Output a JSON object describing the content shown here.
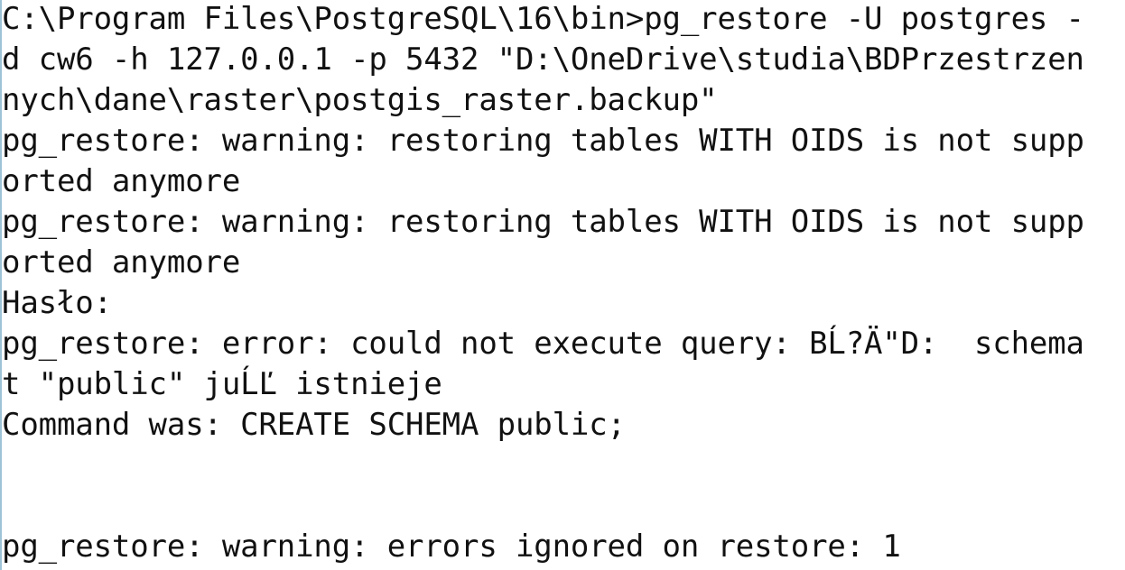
{
  "console": {
    "lines": [
      "C:\\Program Files\\PostgreSQL\\16\\bin>pg_restore -U postgres -",
      "d cw6 -h 127.0.0.1 -p 5432 \"D:\\OneDrive\\studia\\BDPrzestrzen",
      "nych\\dane\\raster\\postgis_raster.backup\"",
      "pg_restore: warning: restoring tables WITH OIDS is not supp",
      "orted anymore",
      "pg_restore: warning: restoring tables WITH OIDS is not supp",
      "orted anymore",
      "Hasło:",
      "pg_restore: error: could not execute query: BĹ?Ä\"D:  schema",
      "t \"public\" juĹĽ istnieje",
      "Command was: CREATE SCHEMA public;",
      "",
      "",
      "pg_restore: warning: errors ignored on restore: 1"
    ]
  }
}
